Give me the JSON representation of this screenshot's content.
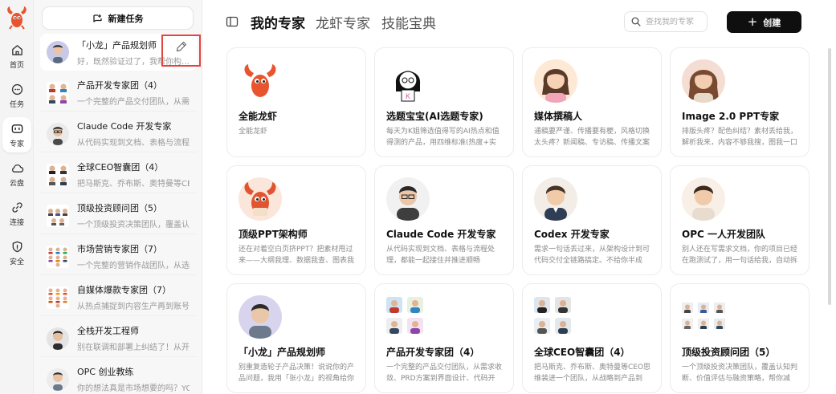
{
  "rail": {
    "items": [
      {
        "label": "首页",
        "icon": "home-icon"
      },
      {
        "label": "任务",
        "icon": "chat-icon"
      },
      {
        "label": "专家",
        "icon": "robot-icon"
      },
      {
        "label": "云盘",
        "icon": "cloud-icon"
      },
      {
        "label": "连接",
        "icon": "link-icon"
      },
      {
        "label": "安全",
        "icon": "shield-icon"
      }
    ],
    "active_index": 2
  },
  "list": {
    "new_task_label": "新建任务",
    "conversations": [
      {
        "title": "「小龙」产品规划师",
        "subtitle": "好，既然验证过了，我帮你构…"
      },
      {
        "title": "产品开发专家团（4）",
        "subtitle": "一个完整的产品交付团队，从需…"
      },
      {
        "title": "Claude Code 开发专家",
        "subtitle": "从代码实现到文档、表格与流程…"
      },
      {
        "title": "全球CEO智囊团（4）",
        "subtitle": "把马斯克、乔布斯、奥特曼等CE…"
      },
      {
        "title": "顶级投资顾问团（5）",
        "subtitle": "一个顶级投资决策团队，覆盖认…"
      },
      {
        "title": "市场营销专家团（7）",
        "subtitle": "一个完整的营销作战团队，从选…"
      },
      {
        "title": "自媒体爆款专家团（7）",
        "subtitle": "从热点捕捉到内容生产再到账号…"
      },
      {
        "title": "全栈开发工程师",
        "subtitle": "别在联调和部署上纠结了！从开…"
      },
      {
        "title": "OPC 创业教练",
        "subtitle": "你的想法真是市场想要的吗？YC …"
      }
    ]
  },
  "header": {
    "tabs": [
      "我的专家",
      "龙虾专家",
      "技能宝典"
    ],
    "active_tab": 0,
    "search_placeholder": "查找我的专家",
    "create_label": "创建"
  },
  "cards": [
    {
      "name": "全能龙虾",
      "desc": "全能龙虾"
    },
    {
      "name": "选题宝宝(AI选题专家)",
      "desc": "每天为K姐筛选值得写的AI热点和值得测的产品，用四维标准(热度+实用+…"
    },
    {
      "name": "媒体撰稿人",
      "desc": "通稿要严谨、传播要有梗，风格切换太头疼？新闻稿、专访稿、传播文案统…"
    },
    {
      "name": "Image 2.0 PPT专家",
      "desc": "排版头疼？配色纠结？素材丢给我，解析我来，内容不够我搜，图我一口气…"
    },
    {
      "name": "顶级PPT架构师",
      "desc": "还在对着空白页挤PPT？把素材甩过来——大纲我理、数据我查、图表我画…"
    },
    {
      "name": "Claude Code 开发专家",
      "desc": "从代码实现到文档、表格与流程处理，都能一起接住并推进顺畅"
    },
    {
      "name": "Codex 开发专家",
      "desc": "需求一句话丢过来，从架构设计到可代码交付全链路搞定。不给你半成品、不…"
    },
    {
      "name": "OPC 一人开发团队",
      "desc": "别人还在写需求文档，你的项目已经在跑测试了，用一句话给我，自动拆需…"
    },
    {
      "name": "「小龙」产品规划师",
      "desc": "别重复造轮子产品决策！说说你的产品问题，我用「张小龙」的视角给你拆。…"
    },
    {
      "name": "产品开发专家团（4）",
      "desc": "一个完整的产品交付团队，从需求收敛、PRD方案到界面设计、代码开发…"
    },
    {
      "name": "全球CEO智囊团（4）",
      "desc": "把马斯克、乔布斯、奥特曼等CEO思维装进一个团队，从战略到产品到融…"
    },
    {
      "name": "顶级投资顾问团（5）",
      "desc": "一个顶级投资决策团队，覆盖认知判断、价值评估与融资策略，帮你减少…"
    }
  ],
  "colors": {
    "accent": "#0f0f0f",
    "highlight": "#e0453e",
    "brand": "#e8542e"
  }
}
